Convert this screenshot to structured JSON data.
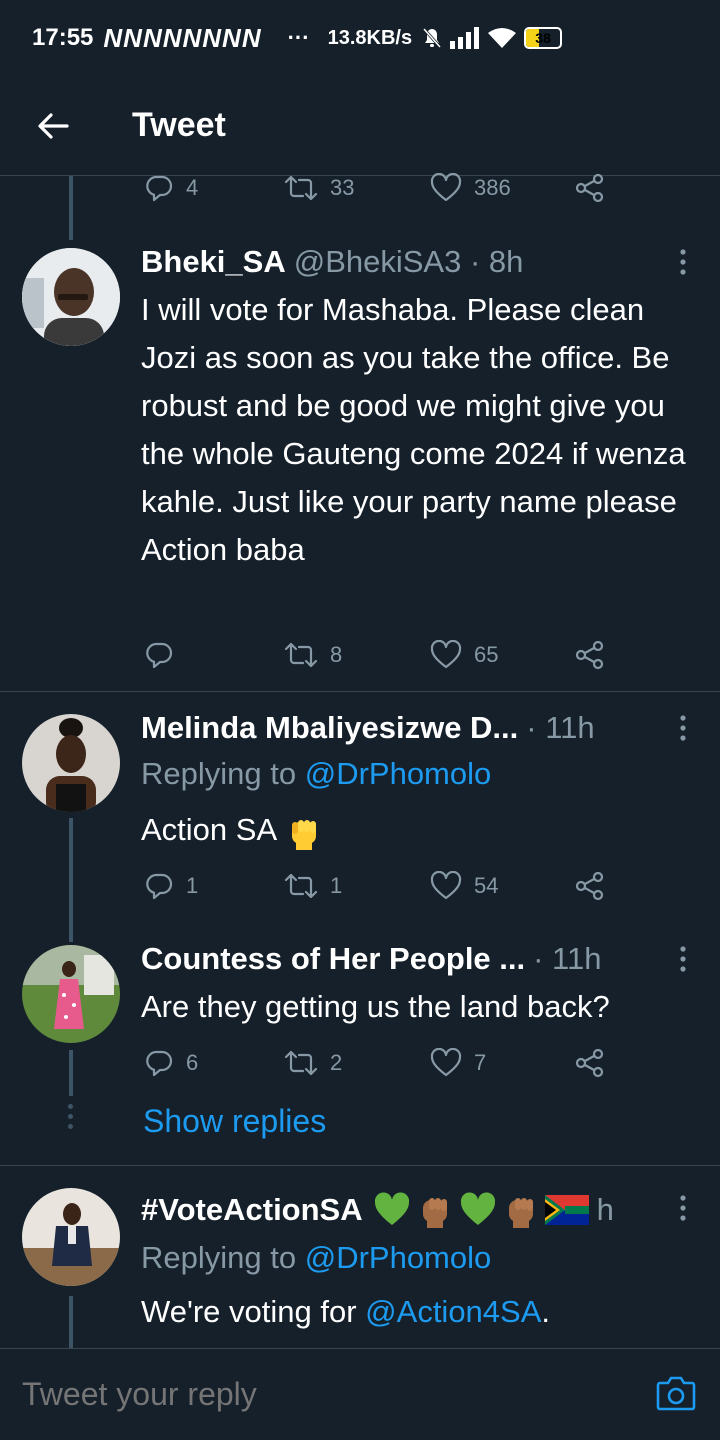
{
  "status_bar": {
    "time": "17:55",
    "notification_icons": "NNNNNNNN",
    "more": "···",
    "speed": "13.8KB/s",
    "battery": "38"
  },
  "header": {
    "title": "Tweet"
  },
  "top_actions": {
    "replies": "4",
    "retweets": "33",
    "likes": "386"
  },
  "tweets": [
    {
      "name": "Bheki_SA",
      "handle": "@BhekiSA3 · 8h",
      "text": "I will vote for Mashaba. Please clean Jozi as soon as you take the office. Be robust and be good we might give you the whole Gauteng come 2024 if wenza kahle. Just like your party name please Action baba",
      "replies": "",
      "retweets": "8",
      "likes": "65"
    },
    {
      "name": "Melinda Mbaliyesizwe D...",
      "handle": "· 11h",
      "replying_prefix": "Replying to",
      "replying_to": "@DrPhomolo",
      "text": "Action SA",
      "replies": "1",
      "retweets": "1",
      "likes": "54"
    },
    {
      "name": "Countess of Her People ...",
      "handle": "· 11h",
      "text": "Are they getting us the land back?",
      "replies": "6",
      "retweets": "2",
      "likes": "7"
    },
    {
      "name": "#VoteActionSA",
      "handle": "h",
      "replying_prefix": "Replying to",
      "replying_to": "@DrPhomolo",
      "text_prefix": "We're voting for",
      "mention": "@Action4SA",
      "text_suffix": "."
    }
  ],
  "show_replies": "Show replies",
  "reply_bar": {
    "placeholder": "Tweet your reply"
  },
  "colors": {
    "background": "#15202b",
    "accent": "#1d9bf0",
    "muted": "#8899a6"
  }
}
